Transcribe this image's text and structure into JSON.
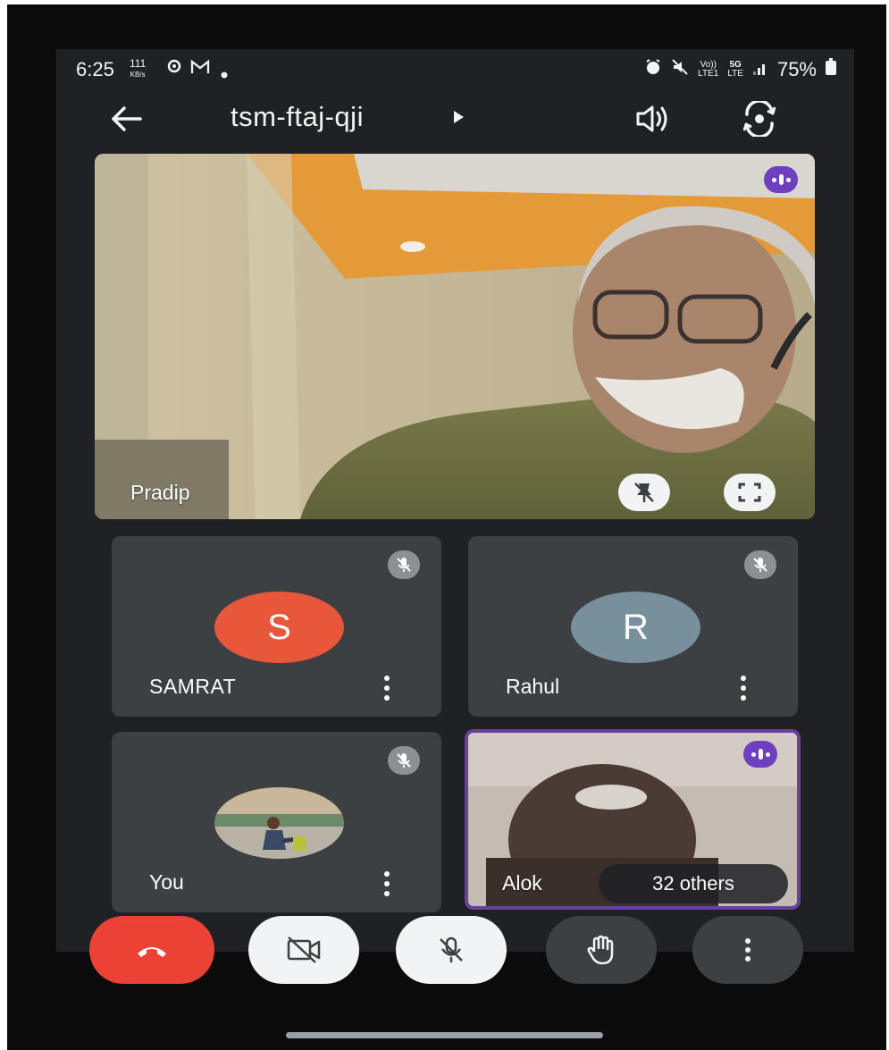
{
  "status_bar": {
    "time": "6:25",
    "net_speed_value": "111",
    "net_speed_unit": "KB/s",
    "volte": "Vo))\nLTE1",
    "network": "5G\nLTE",
    "battery": "75%"
  },
  "toolbar": {
    "meeting_code": "tsm-ftaj-qji"
  },
  "main_tile": {
    "name": "Pradip"
  },
  "participants": [
    {
      "name": "SAMRAT",
      "initial": "S",
      "avatar_color": "#e8573a"
    },
    {
      "name": "Rahul",
      "initial": "R",
      "avatar_color": "#78909c"
    },
    {
      "name": "You"
    },
    {
      "name": "Alok",
      "others": "32 others"
    }
  ],
  "colors": {
    "end_call": "#ea4335",
    "speaking": "#6e3fbf",
    "tile_bg": "#3c4043",
    "screen_bg": "#202124"
  },
  "icons": [
    "arrow-back-icon",
    "speaker-icon",
    "switch-camera-icon",
    "unpin-icon",
    "fullscreen-icon",
    "mic-off-icon",
    "more-vert-icon",
    "end-call-icon",
    "camera-off-icon",
    "raise-hand-icon"
  ]
}
